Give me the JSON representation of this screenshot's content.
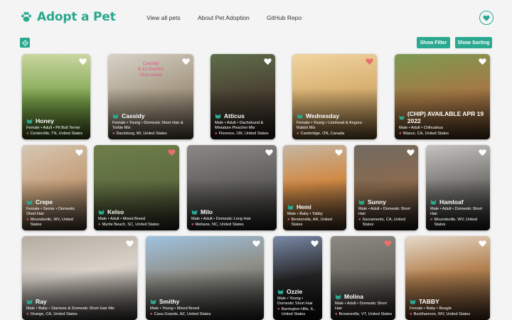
{
  "header": {
    "logo_text": "Adopt a Pet",
    "nav": [
      "View all pets",
      "About Pet Adoption",
      "GitHub Repo"
    ]
  },
  "toolbar": {
    "filter_label": "Show Filter",
    "sort_label": "Show Sorting"
  },
  "colors": {
    "accent": "#2aa890",
    "favorite_active": "#e8706e",
    "pin": "#e75a6a"
  },
  "cards": [
    {
      "name": "Honey",
      "details": "Female • Adult • Pit Bull Terrier",
      "location": "Centerville, TN, United States",
      "favorited": false
    },
    {
      "name": "Cassidy",
      "details": "Female • Young • Domestic Short Hair & Torbie Mix",
      "location": "Davisburg, MI, United States",
      "favorited": false,
      "photo_text": [
        "Cassidy",
        "9-12 months",
        "Very sweet"
      ]
    },
    {
      "name": "Atticus",
      "details": "Male • Adult • Dachshund & Miniature Pinscher Mix",
      "location": "Florence, OR, United States",
      "favorited": false
    },
    {
      "name": "Wednesday",
      "details": "Female • Young • Lionhead & Angora Rabbit Mix",
      "location": "Cambridge, ON, Canada",
      "favorited": true
    },
    {
      "name": "(CHIP) AVAILABLE APR 19 2022",
      "details": "Male • Adult • Chihuahua",
      "location": "Wasco, CA, United States",
      "favorited": false
    },
    {
      "name": "Crepe",
      "details": "Female • Senior • Domestic Short Hair",
      "location": "Moundsville, WV, United States",
      "favorited": false
    },
    {
      "name": "Kelso",
      "details": "Male • Adult • Mixed Breed",
      "location": "Myrtle Beach, SC, United States",
      "favorited": true
    },
    {
      "name": "Milo",
      "details": "Male • Adult • Domestic Long Hair",
      "location": "Mebane, NC, United States",
      "favorited": false
    },
    {
      "name": "Hemi",
      "details": "Male • Baby • Tabby",
      "location": "Bentonville, AR, United States",
      "favorited": false
    },
    {
      "name": "Sunny",
      "details": "Male • Adult • Domestic Short Hair",
      "location": "Sacramento, CA, United States",
      "favorited": false
    },
    {
      "name": "Hamloaf",
      "details": "Male • Adult • Domestic Short Hair",
      "location": "Moundsville, WV, United States",
      "favorited": false
    },
    {
      "name": "Ray",
      "details": "Male • Baby • Siamese & Domestic Short Hair Mix",
      "location": "Orange, CA, United States",
      "favorited": false
    },
    {
      "name": "Smithy",
      "details": "Male • Young • Mixed Breed",
      "location": "Casa Grande, AZ, United States",
      "favorited": false
    },
    {
      "name": "Ozzie",
      "details": "Male • Young • Domestic Short Hair",
      "location": "Barrington Hills, IL, United States",
      "favorited": false
    },
    {
      "name": "Molina",
      "details": "Male • Adult • Domestic Short Hair",
      "location": "Brownsville, VT, United States",
      "favorited": true
    },
    {
      "name": "TABBY",
      "details": "Female • Baby • Beagle",
      "location": "Buckhannon, WV, United States",
      "favorited": false
    }
  ]
}
